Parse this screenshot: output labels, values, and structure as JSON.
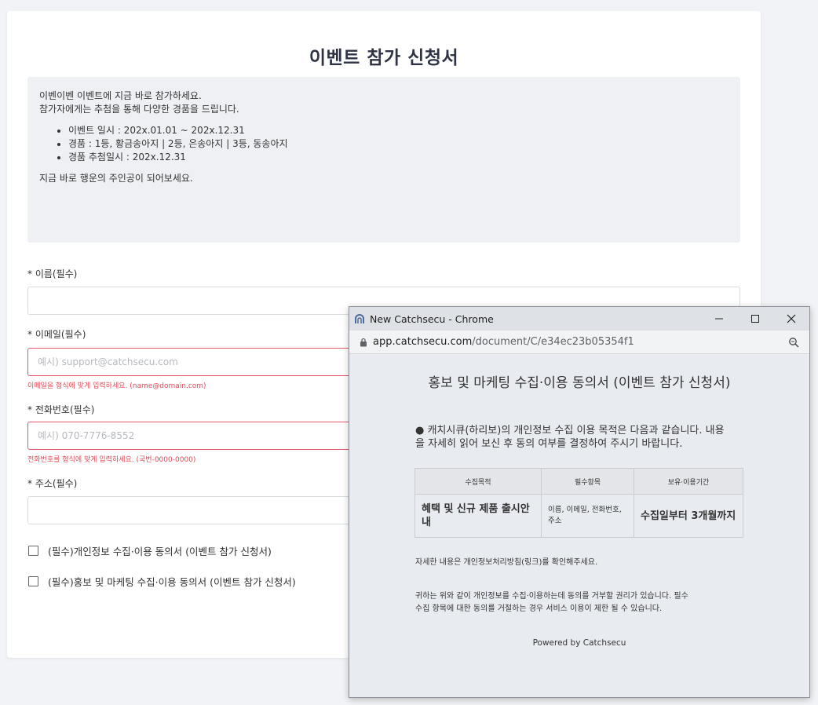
{
  "form": {
    "title": "이벤트 참가 신청서",
    "notice": {
      "line1": "이벤이벤 이벤트에 지금 바로 참가하세요.",
      "line2": "참가자에게는 추첨을 통해 다양한 경품을 드립니다.",
      "items": [
        "이벤트 일시 : 202x.01.01 ~ 202x.12.31",
        "경품 : 1등, 황금송아지  |  2등, 은송아지  | 3등, 동송아지",
        "경품 추첨일시 : 202x.12.31"
      ],
      "closing": "지금 바로 행운의 주인공이 되어보세요."
    },
    "fields": {
      "name_label": "* 이름(필수)",
      "email_label": "* 이메일(필수)",
      "email_placeholder": "예시) support@catchsecu.com",
      "email_error": "이메일을 형식에 맞게 입력하세요. (name@domain.com)",
      "phone_label": "* 전화번호(필수)",
      "phone_placeholder": "예시) 070-7776-8552",
      "phone_error": "전화번호를 형식에 맞게 입력하세요. (국번-0000-0000)",
      "address_label": "* 주소(필수)"
    },
    "checks": {
      "privacy": "(필수)개인정보 수집·이용 동의서 (이벤트 참가 신청서)",
      "marketing": "(필수)홍보 및 마케팅 수집·이용 동의서 (이벤트 참가 신청서)"
    }
  },
  "popup": {
    "window_title": "New Catchsecu - Chrome",
    "url_host": "app.catchsecu.com",
    "url_path": "/document/C/e34ec23b05354f1",
    "consent_title": "홍보 및 마케팅 수집·이용 동의서 (이벤트 참가 신청서)",
    "intro": "● 캐치시큐(하리보)의 개인정보 수집 이용 목적은 다음과 같습니다. 내용을 자세히 읽어 보신 후 동의 여부를 결정하여 주시기 바랍니다.",
    "table": {
      "headers": [
        "수집목적",
        "필수항목",
        "보유·이용기간"
      ],
      "row": [
        "혜택 및 신규 제품 출시안내",
        "이름, 이메일, 전화번호, 주소",
        "수집일부터 3개월까지"
      ]
    },
    "detail_note": "자세한 내용은 개인정보처리방침(링크)를 확인해주세요.",
    "rights_note_1": "귀하는 위와 같이 개인정보를 수집·이용하는데 동의를 거부할 권리가 있습니다. 필수",
    "rights_note_2": "수집 항목에 대한 동의를 거절하는 경우 서비스 이용이 제한 될 수 있습니다.",
    "powered_by": "Powered by Catchsecu"
  }
}
